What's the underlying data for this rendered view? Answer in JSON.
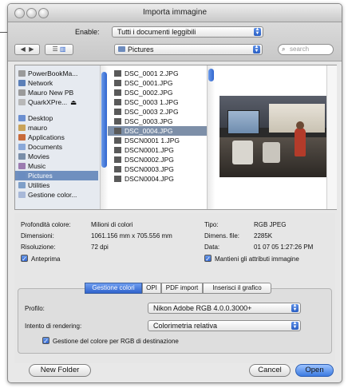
{
  "window": {
    "title": "Importa immagine"
  },
  "toolbar": {
    "enable_label": "Enable:",
    "enable_value": "Tutti i documenti leggibili",
    "location": "Pictures",
    "search_placeholder": "search"
  },
  "sidebar": {
    "items": [
      {
        "label": "PowerBookMa...",
        "icon": "hard-disk-icon"
      },
      {
        "label": "Network",
        "icon": "network-icon"
      },
      {
        "label": "Mauro New PB",
        "icon": "hard-disk-icon"
      },
      {
        "label": "QuarkXPre...",
        "icon": "disk-image-icon",
        "eject": "⏏"
      },
      {
        "label": "Desktop",
        "icon": "desktop-icon"
      },
      {
        "label": "mauro",
        "icon": "home-icon"
      },
      {
        "label": "Applications",
        "icon": "applications-icon"
      },
      {
        "label": "Documents",
        "icon": "documents-icon"
      },
      {
        "label": "Movies",
        "icon": "movies-icon"
      },
      {
        "label": "Music",
        "icon": "music-icon"
      },
      {
        "label": "Pictures",
        "icon": "pictures-icon",
        "selected": true
      },
      {
        "label": "Utilities",
        "icon": "utilities-icon"
      },
      {
        "label": "Gestione color...",
        "icon": "folder-icon"
      }
    ]
  },
  "files": [
    {
      "name": "DSC_0001 2.JPG"
    },
    {
      "name": "DSC_0001.JPG"
    },
    {
      "name": "DSC_0002.JPG"
    },
    {
      "name": "DSC_0003 1.JPG"
    },
    {
      "name": "DSC_0003 2.JPG"
    },
    {
      "name": "DSC_0003.JPG"
    },
    {
      "name": "DSC_0004.JPG",
      "selected": true
    },
    {
      "name": "DSCN0001 1.JPG"
    },
    {
      "name": "DSCN0001.JPG"
    },
    {
      "name": "DSCN0002.JPG"
    },
    {
      "name": "DSCN0003.JPG"
    },
    {
      "name": "DSCN0004.JPG"
    }
  ],
  "info": {
    "depth_label": "Profondità colore:",
    "depth_value": "Milioni di colori",
    "dims_label": "Dimensioni:",
    "dims_value": "1061.156 mm x 705.556 mm",
    "res_label": "Risoluzione:",
    "res_value": "72 dpi",
    "type_label": "Tipo:",
    "type_value": "RGB JPEG",
    "size_label": "Dimens. file:",
    "size_value": "2285K",
    "date_label": "Data:",
    "date_value": "01 07 05 1:27:26 PM",
    "preview_label": "Anteprima",
    "keep_label": "Mantieni gli attributi immagine"
  },
  "tabs": [
    {
      "label": "Gestione colori",
      "active": true
    },
    {
      "label": "OPI"
    },
    {
      "label": "PDF import"
    },
    {
      "label": "Inserisci il grafico"
    }
  ],
  "color": {
    "profile_label": "Profilo:",
    "profile_value": "Nikon Adobe RGB 4.0.0.3000+",
    "intent_label": "Intento di rendering:",
    "intent_value": "Colorimetria relativa",
    "dest_label": "Gestione del colore per RGB di destinazione"
  },
  "buttons": {
    "new_folder": "New Folder",
    "cancel": "Cancel",
    "open": "Open"
  },
  "colors": {
    "accent": "#3b7ae0",
    "selection": "#7d8fa8"
  }
}
